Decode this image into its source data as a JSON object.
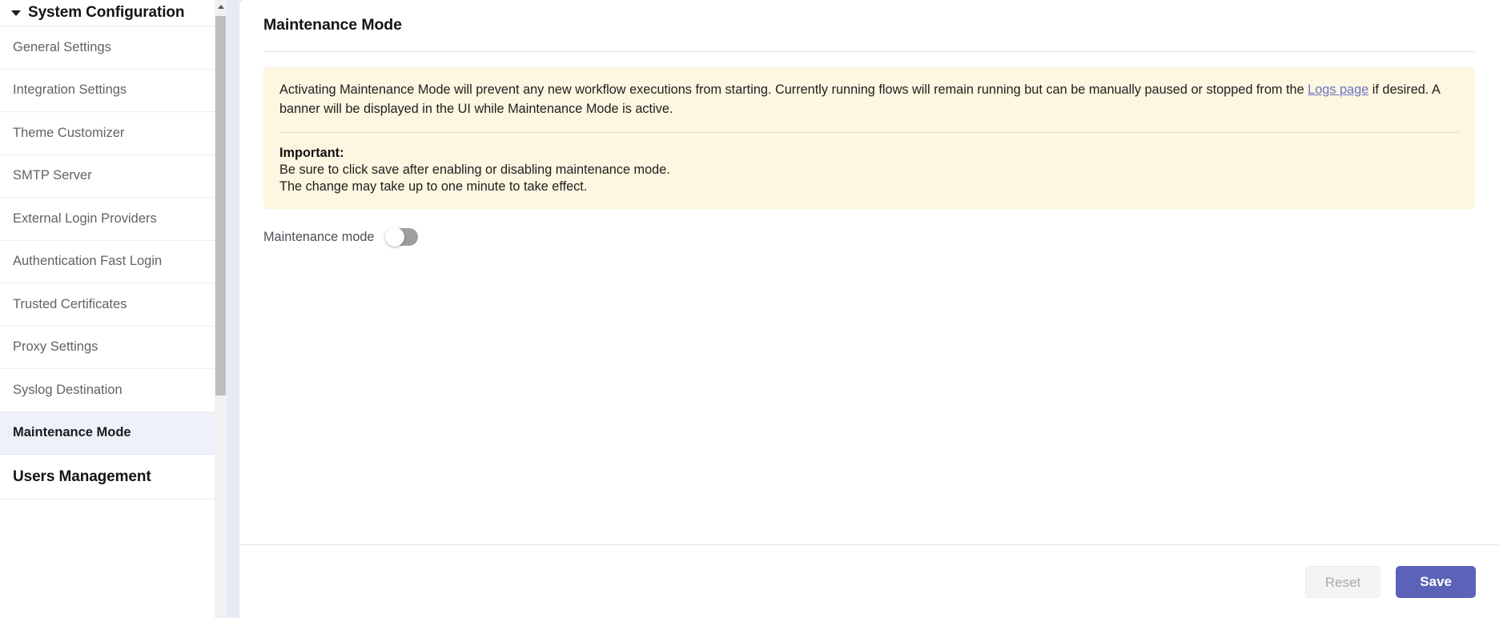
{
  "sidebar": {
    "section": {
      "title": "System Configuration",
      "caret_icon": "caret-down-icon",
      "expanded": true
    },
    "items": [
      {
        "label": "General Settings",
        "active": false
      },
      {
        "label": "Integration Settings",
        "active": false
      },
      {
        "label": "Theme Customizer",
        "active": false
      },
      {
        "label": "SMTP Server",
        "active": false
      },
      {
        "label": "External Login Providers",
        "active": false
      },
      {
        "label": "Authentication Fast Login",
        "active": false
      },
      {
        "label": "Trusted Certificates",
        "active": false
      },
      {
        "label": "Proxy Settings",
        "active": false
      },
      {
        "label": "Syslog Destination",
        "active": false
      },
      {
        "label": "Maintenance Mode",
        "active": true
      }
    ],
    "groups": [
      {
        "label": "Users Management"
      }
    ],
    "scrollbar": {
      "up_arrow_icon": "scroll-up-arrow-icon"
    }
  },
  "main": {
    "page_title": "Maintenance Mode",
    "notice": {
      "paragraph_before_link": "Activating Maintenance Mode will prevent any new workflow executions from starting. Currently running flows will remain running but can be manually paused or stopped from the ",
      "link_label": "Logs page",
      "paragraph_after_link": " if desired. A banner will be displayed in the UI while Maintenance Mode is active.",
      "important_label": "Important:",
      "important_lines": [
        "Be sure to click save after enabling or disabling maintenance mode.",
        "The change may take up to one minute to take effect."
      ]
    },
    "toggle": {
      "label": "Maintenance mode",
      "checked": false
    }
  },
  "footer": {
    "reset_label": "Reset",
    "save_label": "Save"
  },
  "colors": {
    "accent": "#5a63b8",
    "notice_bg": "#fdf6e0",
    "active_sidebar_bg": "#eef0fa",
    "link": "#6b74c4"
  }
}
